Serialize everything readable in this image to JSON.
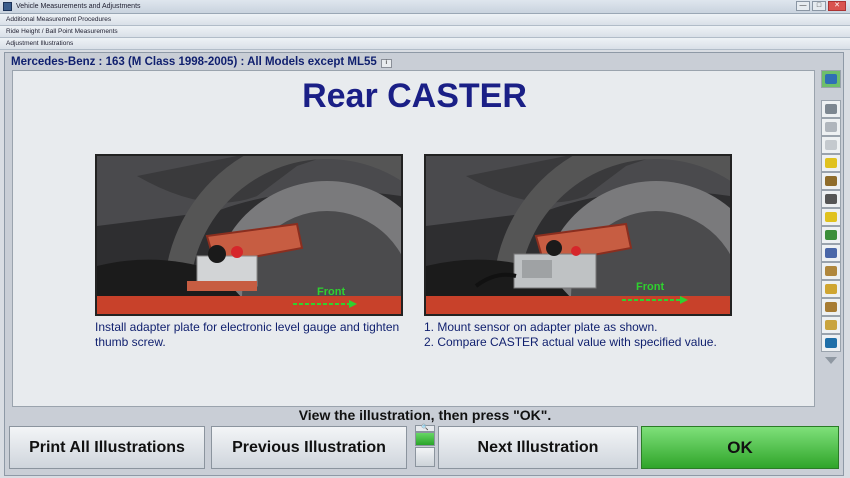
{
  "window": {
    "title": "Vehicle Measurements and Adjustments",
    "buttons": [
      "—",
      "□",
      "✕"
    ]
  },
  "tabs": [
    "Additional Measurement Procedures",
    "Ride Height / Ball Point Measurements",
    "Adjustment Illustrations"
  ],
  "vehicle": "Mercedes-Benz : 163 (M Class 1998-2005) : All Models except ML55",
  "page_title": "Rear CASTER",
  "illustrations": [
    {
      "label": "Front",
      "caption": "Install adapter plate for electronic level gauge and tighten thumb screw."
    },
    {
      "label": "Front",
      "caption_lines": [
        "1. Mount sensor on adapter plate as shown.",
        "2. Compare CASTER actual value with specified value."
      ]
    }
  ],
  "prompt": "View the illustration, then press \"OK\".",
  "buttons": {
    "print": "Print All Illustrations",
    "previous": "Previous Illustration",
    "next": "Next Illustration",
    "ok": "OK"
  },
  "zoom_icon": "magnifier-icon",
  "colors": {
    "title": "#1a1f86",
    "ok": "#3dbb38",
    "arrow": "#2fd12f"
  }
}
